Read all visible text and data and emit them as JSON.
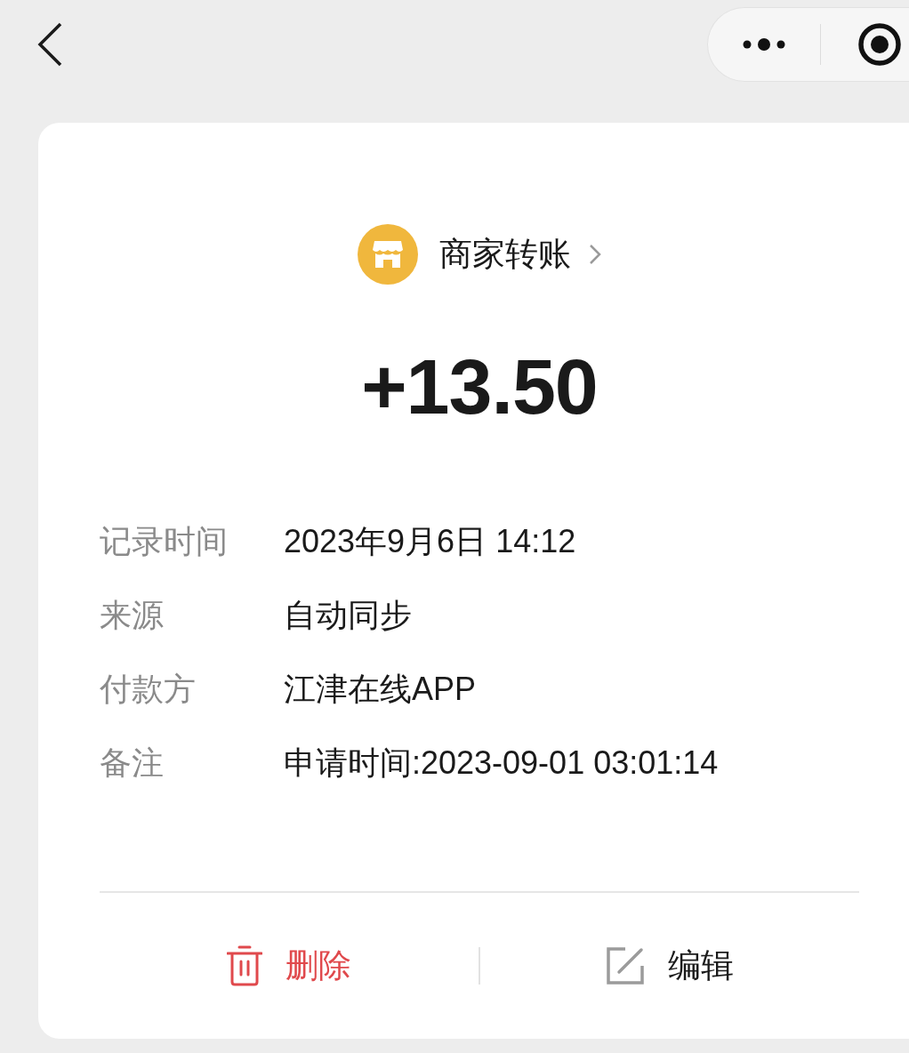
{
  "merchant": {
    "title": "商家转账"
  },
  "amount": "+13.50",
  "details": [
    {
      "label": "记录时间",
      "value": "2023年9月6日 14:12"
    },
    {
      "label": "来源",
      "value": "自动同步"
    },
    {
      "label": "付款方",
      "value": "江津在线APP"
    },
    {
      "label": "备注",
      "value": "申请时间:2023-09-01 03:01:14"
    }
  ],
  "actions": [
    {
      "kind": "delete",
      "label": "删除"
    },
    {
      "kind": "edit",
      "label": "编辑"
    }
  ]
}
